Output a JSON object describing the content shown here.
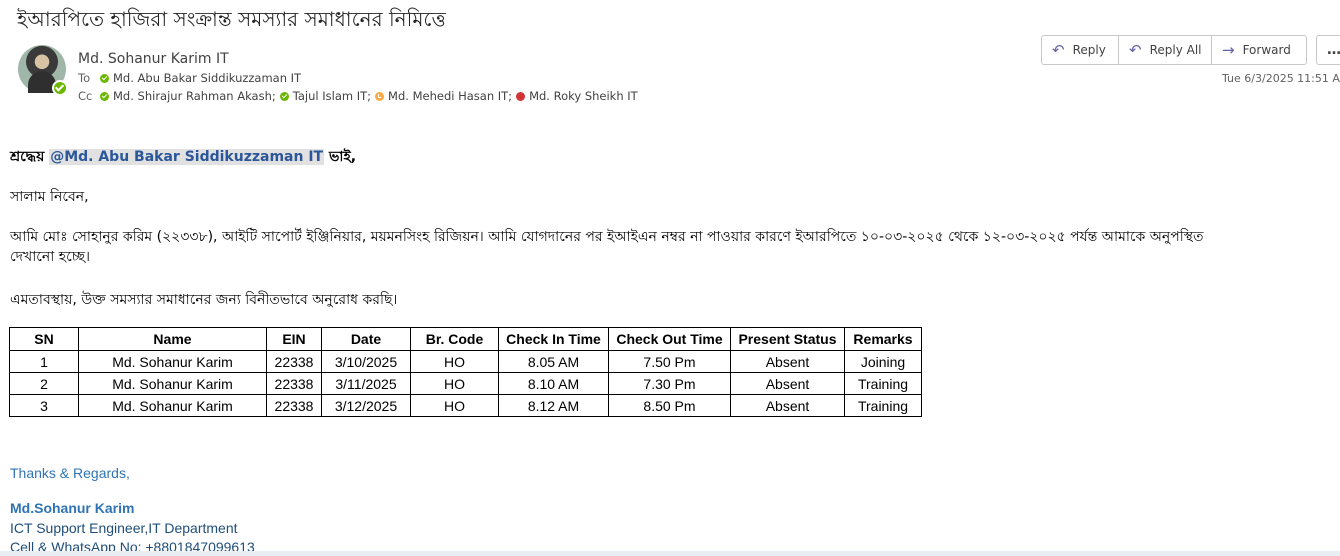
{
  "subject": "ইআরপিতে হাজিরা সংক্রান্ত সমস্যার সমাধানের নিমিত্তে",
  "header": {
    "sender": "Md. Sohanur Karim IT",
    "to_label": "To",
    "to": [
      {
        "name": "Md. Abu Bakar Siddikuzzaman IT",
        "presence": "available"
      }
    ],
    "cc_label": "Cc",
    "cc": [
      {
        "name": "Md. Shirajur Rahman Akash;",
        "presence": "available"
      },
      {
        "name": "Tajul Islam IT;",
        "presence": "available"
      },
      {
        "name": "Md. Mehedi Hasan IT;",
        "presence": "away"
      },
      {
        "name": "Md. Roky Sheikh IT",
        "presence": "busy"
      }
    ],
    "timestamp": "Tue 6/3/2025 11:51 AM"
  },
  "actions": {
    "reply": "Reply",
    "reply_all": "Reply All",
    "forward": "Forward",
    "more": "…"
  },
  "icons": {
    "reply": "reply-arrow-icon",
    "reply_all": "reply-all-arrow-icon",
    "forward": "forward-arrow-icon",
    "more": "more-horizontal-icon",
    "presence": "presence-status-icon"
  },
  "body": {
    "greeting_prefix": "শ্রদ্ধেয় ",
    "mention": "@Md. Abu Bakar Siddikuzzaman IT",
    "greeting_suffix": " ভাই,",
    "salam": "সালাম নিবেন,",
    "para1_line1": "আমি মোঃ সোহানুর করিম (২২৩৩৮), আইটি সাপোর্ট ইঞ্জিনিয়ার, ময়মনসিংহ রিজিয়ন। আমি যোগদানের পর ইআইএন নম্বর না পাওয়ার কারণে ইআরপিতে ১০-০৩-২০২৫ থেকে ১২-০৩-২০২৫ পর্যন্ত আমাকে অনুপস্থিত",
    "para1_line2": "দেখানো হচ্ছে।",
    "para2": "এমতাবস্থায়, উক্ত সমস্যার সমাধানের জন্য বিনীতভাবে অনুরোধ করছি।"
  },
  "table": {
    "headers": [
      "SN",
      "Name",
      "EIN",
      "Date",
      "Br. Code",
      "Check In Time",
      "Check Out Time",
      "Present Status",
      "Remarks"
    ],
    "rows": [
      [
        "1",
        "Md. Sohanur Karim",
        "22338",
        "3/10/2025",
        "HO",
        "8.05 AM",
        "7.50 Pm",
        "Absent",
        "Joining"
      ],
      [
        "2",
        "Md. Sohanur Karim",
        "22338",
        "3/11/2025",
        "HO",
        "8.10 AM",
        "7.30 Pm",
        "Absent",
        "Training"
      ],
      [
        "3",
        "Md. Sohanur Karim",
        "22338",
        "3/12/2025",
        "HO",
        "8.12 AM",
        "8.50 Pm",
        "Absent",
        "Training"
      ]
    ]
  },
  "signature": {
    "thanks": "Thanks & Regards,",
    "name": "Md.Sohanur Karim",
    "title": "ICT Support Engineer,IT Department",
    "phone": "Cell & WhatsApp No: +8801847099613"
  },
  "colors": {
    "accent": "#6264a7",
    "available": "#6bb700",
    "away": "#ffaa44",
    "busy": "#d13438",
    "mention": "#2b579a",
    "signature": "#2e74b5"
  }
}
